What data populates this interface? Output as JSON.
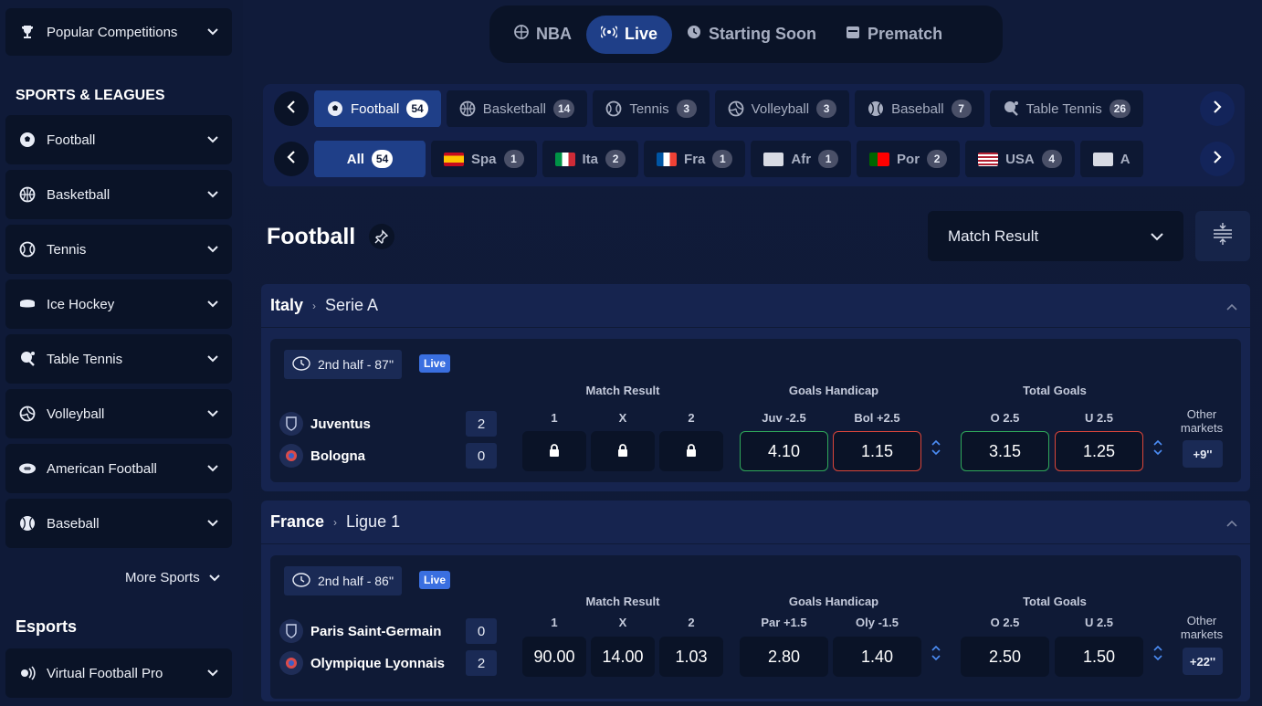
{
  "sidebar": {
    "popular": "Popular Competitions",
    "sports_title": "SPORTS & LEAGUES",
    "sports": [
      {
        "label": "Football",
        "icon": "football-icon"
      },
      {
        "label": "Basketball",
        "icon": "basketball-icon"
      },
      {
        "label": "Tennis",
        "icon": "tennis-icon"
      },
      {
        "label": "Ice Hockey",
        "icon": "ice-hockey-icon"
      },
      {
        "label": "Table Tennis",
        "icon": "table-tennis-icon"
      },
      {
        "label": "Volleyball",
        "icon": "volleyball-icon"
      },
      {
        "label": "American Football",
        "icon": "american-football-icon"
      },
      {
        "label": "Baseball",
        "icon": "baseball-icon"
      }
    ],
    "more": "More Sports",
    "esports_title": "Esports",
    "esports": [
      {
        "label": "Virtual Football Pro",
        "icon": "virtual-icon"
      }
    ]
  },
  "topnav": {
    "tabs": [
      {
        "label": "NBA"
      },
      {
        "label": "Live"
      },
      {
        "label": "Starting Soon"
      },
      {
        "label": "Prematch"
      }
    ],
    "active": "Live"
  },
  "sport_filters": [
    {
      "label": "Football",
      "count": "54"
    },
    {
      "label": "Basketball",
      "count": "14"
    },
    {
      "label": "Tennis",
      "count": "3"
    },
    {
      "label": "Volleyball",
      "count": "3"
    },
    {
      "label": "Baseball",
      "count": "7"
    },
    {
      "label": "Table Tennis",
      "count": "26"
    }
  ],
  "country_filters": [
    {
      "label": "All",
      "count": "54"
    },
    {
      "label": "Spa",
      "count": "1",
      "colors": [
        "#c60b1e",
        "#ffc400"
      ]
    },
    {
      "label": "Ita",
      "count": "2",
      "colors": [
        "#009246",
        "#ffffff",
        "#ce2b37"
      ]
    },
    {
      "label": "Fra",
      "count": "1",
      "colors": [
        "#0055a4",
        "#ffffff",
        "#ef4135"
      ]
    },
    {
      "label": "Afr",
      "count": "1",
      "colors": [
        "#ffffff"
      ]
    },
    {
      "label": "Por",
      "count": "2",
      "colors": [
        "#006600",
        "#ff0000"
      ]
    },
    {
      "label": "USA",
      "count": "4",
      "colors": [
        "#b22234",
        "#ffffff"
      ]
    },
    {
      "label": "A",
      "count": "",
      "colors": [
        "#ffffff"
      ]
    }
  ],
  "page": {
    "title": "Football",
    "market_select": "Match Result"
  },
  "leagues": [
    {
      "country": "Italy",
      "league": "Serie A",
      "match": {
        "status": "2nd half - 87''",
        "live": "Live",
        "home": "Juventus",
        "away": "Bologna",
        "home_score": "2",
        "away_score": "0",
        "market1": {
          "title": "Match Result",
          "labels": [
            "1",
            "X",
            "2"
          ],
          "odds": [
            "",
            "",
            ""
          ],
          "locked": true
        },
        "market2": {
          "title": "Goals Handicap",
          "labels": [
            "Juv -2.5",
            "Bol +2.5"
          ],
          "odds": [
            "4.10",
            "1.15"
          ]
        },
        "market3": {
          "title": "Total Goals",
          "labels": [
            "O 2.5",
            "U 2.5"
          ],
          "odds": [
            "3.15",
            "1.25"
          ]
        },
        "other": "Other markets",
        "more": "+9''"
      }
    },
    {
      "country": "France",
      "league": "Ligue 1",
      "match": {
        "status": "2nd half - 86''",
        "live": "Live",
        "home": "Paris Saint-Germain",
        "away": "Olympique Lyonnais",
        "home_score": "0",
        "away_score": "2",
        "market1": {
          "title": "Match Result",
          "labels": [
            "1",
            "X",
            "2"
          ],
          "odds": [
            "90.00",
            "14.00",
            "1.03"
          ],
          "locked": false
        },
        "market2": {
          "title": "Goals Handicap",
          "labels": [
            "Par +1.5",
            "Oly -1.5"
          ],
          "odds": [
            "2.80",
            "1.40"
          ]
        },
        "market3": {
          "title": "Total Goals",
          "labels": [
            "O 2.5",
            "U 2.5"
          ],
          "odds": [
            "2.50",
            "1.50"
          ]
        },
        "other": "Other markets",
        "more": "+22''"
      }
    }
  ]
}
